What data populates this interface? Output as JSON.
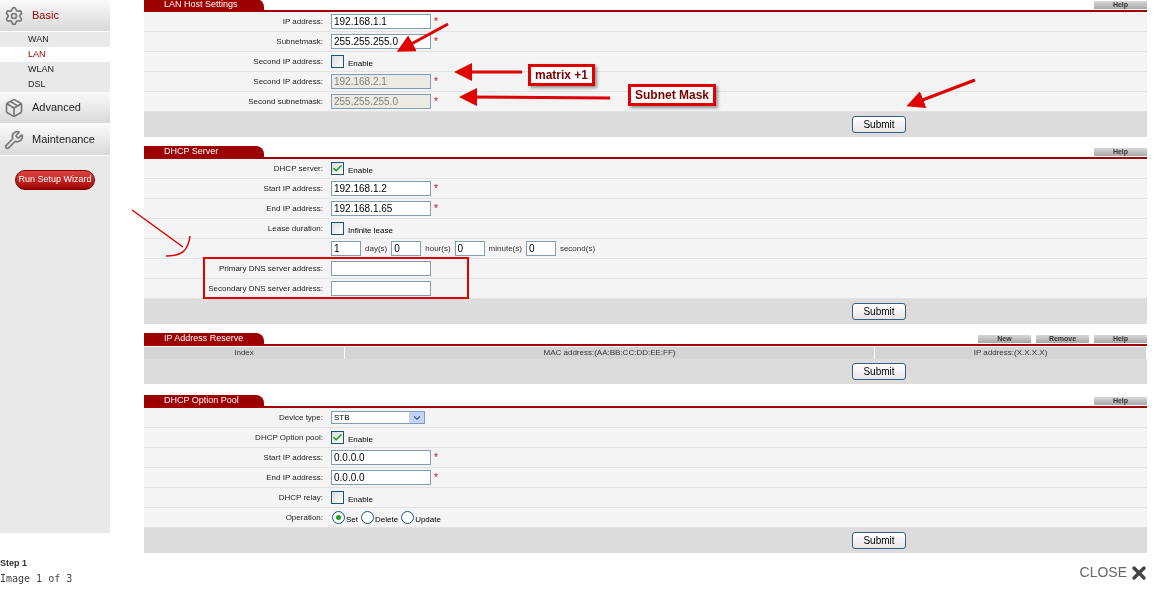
{
  "sidebar": {
    "sections": [
      {
        "label": "Basic",
        "selected": true,
        "children": [
          {
            "label": "WAN",
            "selected": false
          },
          {
            "label": "LAN",
            "selected": true
          },
          {
            "label": "WLAN",
            "selected": false
          },
          {
            "label": "DSL",
            "selected": false
          }
        ]
      },
      {
        "label": "Advanced",
        "selected": false
      },
      {
        "label": "Maintenance",
        "selected": false
      }
    ],
    "wizard_button": "Run Setup Wizard"
  },
  "panels": [
    {
      "title": "LAN Host Settings",
      "buttons": [
        "Help"
      ],
      "submit": "Submit",
      "rows": [
        {
          "kind": "text",
          "label": "IP address:",
          "value": "192.168.1.1",
          "mark": "*",
          "disabled": false
        },
        {
          "kind": "text",
          "label": "Subnetmask:",
          "value": "255.255.255.0",
          "mark": "*",
          "disabled": false
        },
        {
          "kind": "checkbox",
          "label": "Second IP address:",
          "checked": false,
          "text": "Enable"
        },
        {
          "kind": "text",
          "label": "Second IP address:",
          "value": "192.168.2.1",
          "mark": "*",
          "disabled": true
        },
        {
          "kind": "text",
          "label": "Second subnetmask:",
          "value": "255.255.255.0",
          "mark": "*",
          "disabled": true
        }
      ]
    },
    {
      "title": "DHCP Server",
      "buttons": [
        "Help"
      ],
      "submit": "Submit",
      "rows": [
        {
          "kind": "checkbox",
          "label": "DHCP server:",
          "checked": true,
          "text": "Enable"
        },
        {
          "kind": "text",
          "label": "Start IP address:",
          "value": "192.168.1.2",
          "mark": "*",
          "disabled": false
        },
        {
          "kind": "text",
          "label": "End IP address:",
          "value": "192.168.1.65",
          "mark": "*",
          "disabled": false
        },
        {
          "kind": "checkbox",
          "label": "Lease duration:",
          "checked": false,
          "text": "Infinite lease"
        },
        {
          "kind": "duration",
          "fields": [
            {
              "value": "1",
              "unit": "day(s)"
            },
            {
              "value": "0",
              "unit": "hour(s)"
            },
            {
              "value": "0",
              "unit": "minute(s)"
            },
            {
              "value": "0",
              "unit": "second(s)"
            }
          ]
        },
        {
          "kind": "text",
          "label": "Primary DNS server address:",
          "disabled": false
        },
        {
          "kind": "text",
          "label": "Secondary DNS server address:",
          "disabled": false
        }
      ]
    },
    {
      "title": "IP Address Reserve",
      "buttons": [
        "New",
        "Remove",
        "Help"
      ],
      "submit": "Submit",
      "columns": [
        "Index",
        "MAC address:(AA:BB:CC:DD:EE:FF)",
        "IP address:(X.X.X.X)"
      ]
    },
    {
      "title": "DHCP Option Pool",
      "buttons": [
        "Help"
      ],
      "submit": "Submit",
      "rows": [
        {
          "kind": "select",
          "label": "Device type:",
          "value": "STB"
        },
        {
          "kind": "checkbox",
          "label": "DHCP Option pool:",
          "checked": true,
          "text": "Enable"
        },
        {
          "kind": "text",
          "label": "Start IP address:",
          "value": "0.0.0.0",
          "mark": "*",
          "disabled": false
        },
        {
          "kind": "text",
          "label": "End IP address:",
          "value": "0.0.0.0",
          "mark": "*",
          "disabled": false
        },
        {
          "kind": "checkbox",
          "label": "DHCP relay:",
          "checked": false,
          "text": "Enable"
        },
        {
          "kind": "radio",
          "label": "Operation:",
          "options": [
            {
              "label": "Set",
              "selected": true
            },
            {
              "label": "Delete",
              "selected": false
            },
            {
              "label": "Update",
              "selected": false
            }
          ]
        }
      ]
    }
  ],
  "callouts": [
    "matrix +1",
    "Subnet Mask"
  ],
  "footer": {
    "step": "Step 1",
    "counter": "Image 1 of 3",
    "close": "CLOSE"
  }
}
